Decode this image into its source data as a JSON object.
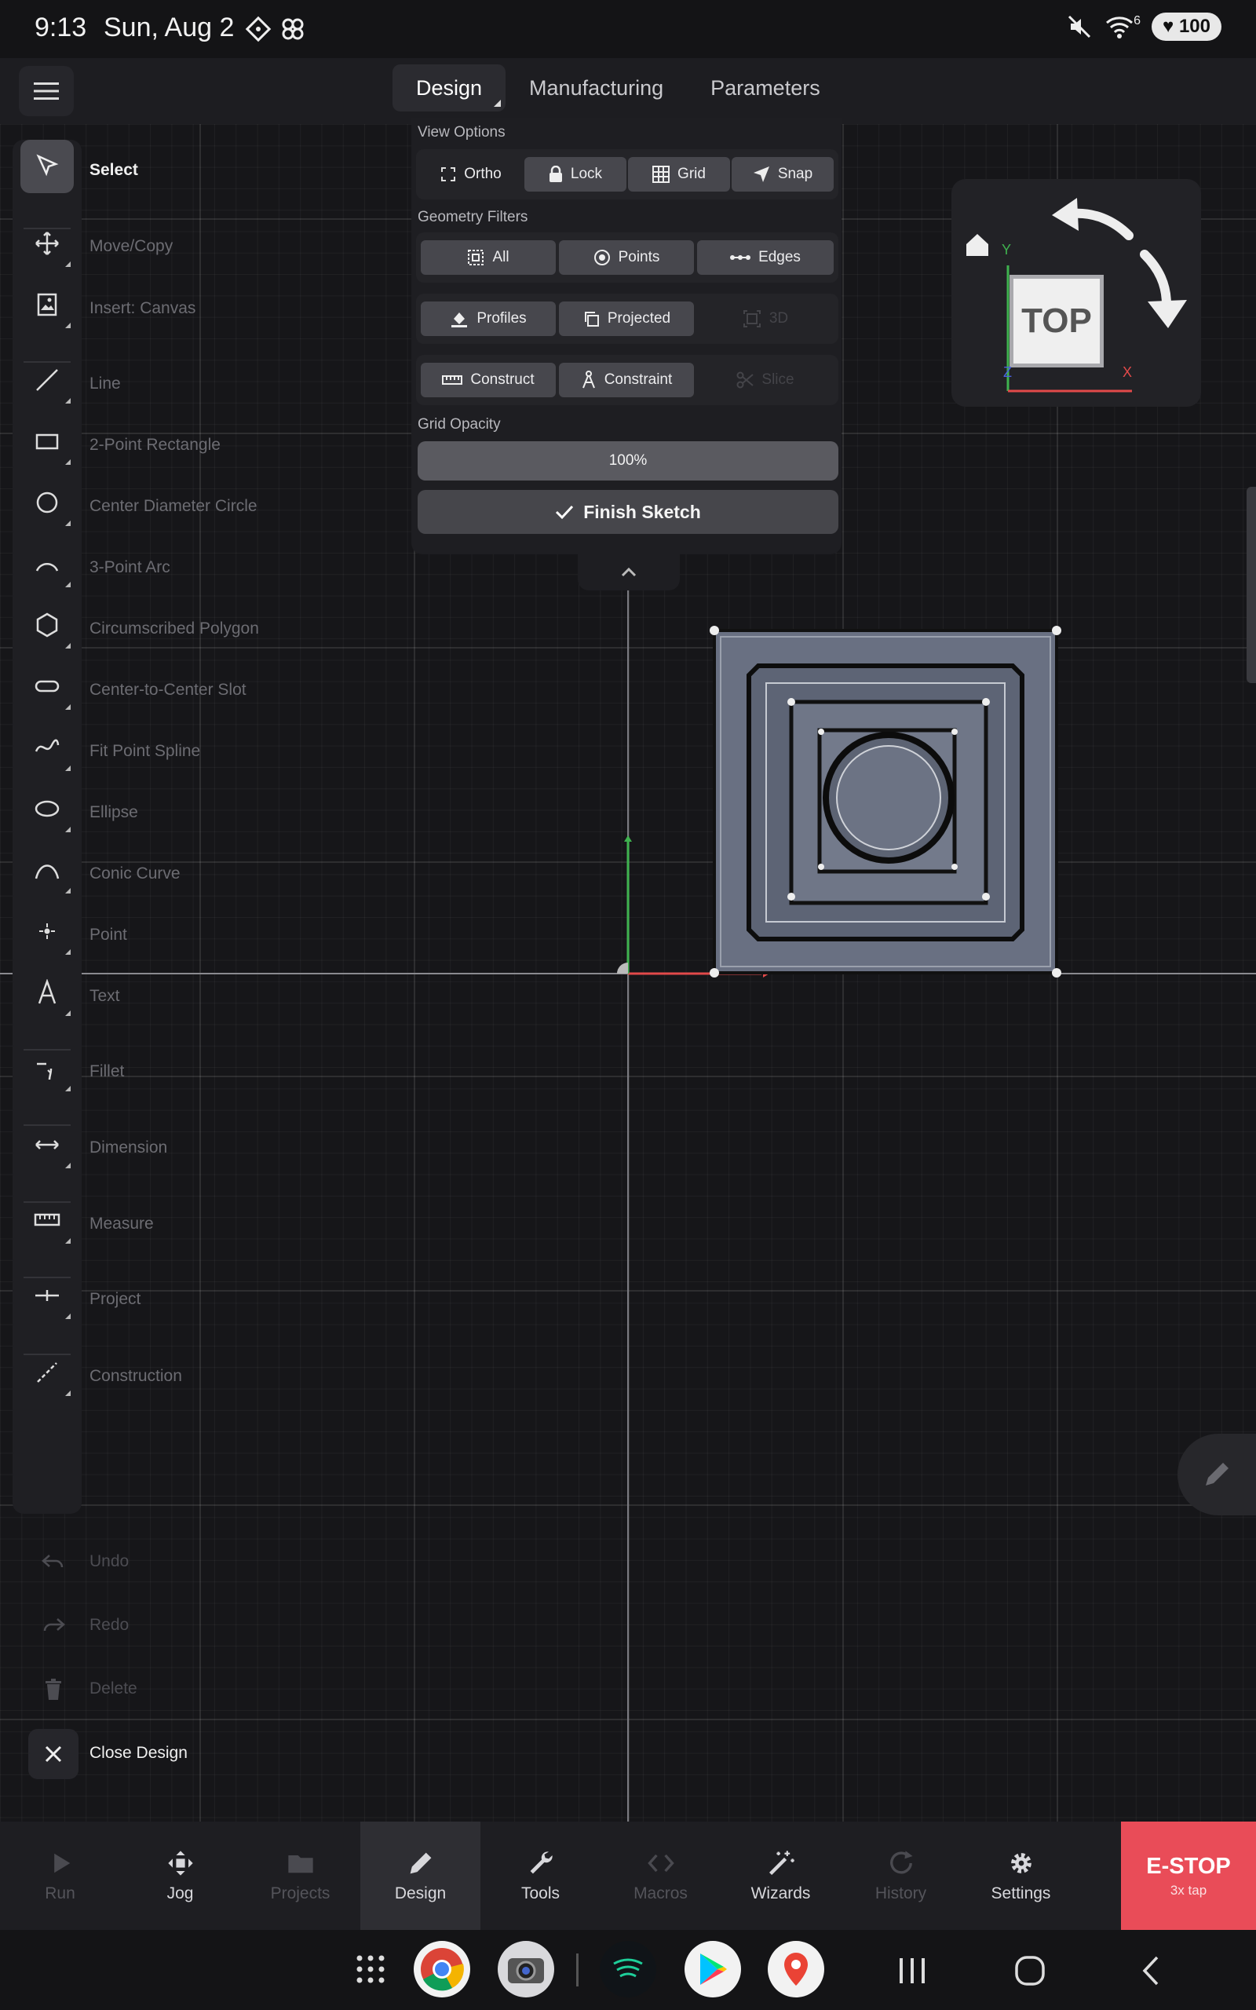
{
  "status_bar": {
    "time": "9:13",
    "date": "Sun, Aug 2",
    "battery": "100",
    "signal_label": "6"
  },
  "top_tabs": [
    {
      "label": "Design",
      "active": true
    },
    {
      "label": "Manufacturing",
      "active": false
    },
    {
      "label": "Parameters",
      "active": false
    }
  ],
  "tools": [
    {
      "label": "Select",
      "icon": "cursor-icon",
      "selected": true
    },
    {
      "label": "Move/Copy",
      "icon": "move-icon"
    },
    {
      "label": "Insert: Canvas",
      "icon": "insert-canvas-icon"
    },
    {
      "label": "Line",
      "icon": "line-icon"
    },
    {
      "label": "2-Point Rectangle",
      "icon": "rectangle-icon"
    },
    {
      "label": "Center Diameter Circle",
      "icon": "circle-icon"
    },
    {
      "label": "3-Point Arc",
      "icon": "arc-icon"
    },
    {
      "label": "Circumscribed Polygon",
      "icon": "hexagon-icon"
    },
    {
      "label": "Center-to-Center Slot",
      "icon": "slot-icon"
    },
    {
      "label": "Fit Point Spline",
      "icon": "spline-icon"
    },
    {
      "label": "Ellipse",
      "icon": "ellipse-icon"
    },
    {
      "label": "Conic Curve",
      "icon": "conic-icon"
    },
    {
      "label": "Point",
      "icon": "point-icon"
    },
    {
      "label": "Text",
      "icon": "text-icon"
    },
    {
      "label": "Fillet",
      "icon": "fillet-icon"
    },
    {
      "label": "Dimension",
      "icon": "dimension-icon"
    },
    {
      "label": "Measure",
      "icon": "ruler-icon"
    },
    {
      "label": "Project",
      "icon": "project-icon"
    },
    {
      "label": "Construction",
      "icon": "construction-icon"
    }
  ],
  "actions": [
    {
      "label": "Undo",
      "icon": "undo-icon",
      "enabled": false
    },
    {
      "label": "Redo",
      "icon": "redo-icon",
      "enabled": false
    },
    {
      "label": "Delete",
      "icon": "trash-icon",
      "enabled": false
    },
    {
      "label": "Close Design",
      "icon": "close-icon",
      "enabled": true
    }
  ],
  "view_panel": {
    "view_options_heading": "View Options",
    "view_options": [
      {
        "label": "Ortho",
        "icon": "fullscreen-icon",
        "active": false
      },
      {
        "label": "Lock",
        "icon": "lock-icon",
        "active": true
      },
      {
        "label": "Grid",
        "icon": "grid-icon",
        "active": true
      },
      {
        "label": "Snap",
        "icon": "snap-arrow-icon",
        "active": true
      }
    ],
    "geometry_filters_heading": "Geometry Filters",
    "filters_row1": [
      {
        "label": "All",
        "icon": "select-all-icon"
      },
      {
        "label": "Points",
        "icon": "target-icon"
      },
      {
        "label": "Edges",
        "icon": "edges-icon"
      }
    ],
    "filters_row2": [
      {
        "label": "Profiles",
        "icon": "fill-icon",
        "enabled": true
      },
      {
        "label": "Projected",
        "icon": "copy-icon",
        "enabled": true
      },
      {
        "label": "3D",
        "icon": "3d-icon",
        "enabled": false
      }
    ],
    "filters_row3": [
      {
        "label": "Construct",
        "icon": "ruler-icon",
        "enabled": true
      },
      {
        "label": "Constraint",
        "icon": "compass-icon",
        "enabled": true
      },
      {
        "label": "Slice",
        "icon": "scissors-icon",
        "enabled": false
      }
    ],
    "grid_opacity_label": "Grid Opacity",
    "grid_opacity_value": "100%",
    "finish_sketch": "Finish Sketch"
  },
  "view_cube": {
    "face": "TOP",
    "axis_x": "X",
    "axis_y": "Y",
    "axis_z": "Z"
  },
  "bottom_nav": [
    {
      "label": "Run",
      "icon": "play-icon",
      "state": "dim"
    },
    {
      "label": "Jog",
      "icon": "jog-arrows-icon",
      "state": "normal"
    },
    {
      "label": "Projects",
      "icon": "folder-icon",
      "state": "dim"
    },
    {
      "label": "Design",
      "icon": "pencil-icon",
      "state": "active"
    },
    {
      "label": "Tools",
      "icon": "wrench-icon",
      "state": "normal"
    },
    {
      "label": "Macros",
      "icon": "code-icon",
      "state": "dim"
    },
    {
      "label": "Wizards",
      "icon": "magic-wand-icon",
      "state": "normal"
    },
    {
      "label": "History",
      "icon": "history-icon",
      "state": "dim"
    },
    {
      "label": "Settings",
      "icon": "gear-icon",
      "state": "normal"
    }
  ],
  "estop": {
    "label": "E-STOP",
    "sub": "3x tap"
  },
  "colors": {
    "estop": "#e94c58",
    "axis_x": "#e24a4a",
    "axis_y": "#3fb24f",
    "axis_z": "#4a63e0",
    "part": "#6b7282"
  }
}
